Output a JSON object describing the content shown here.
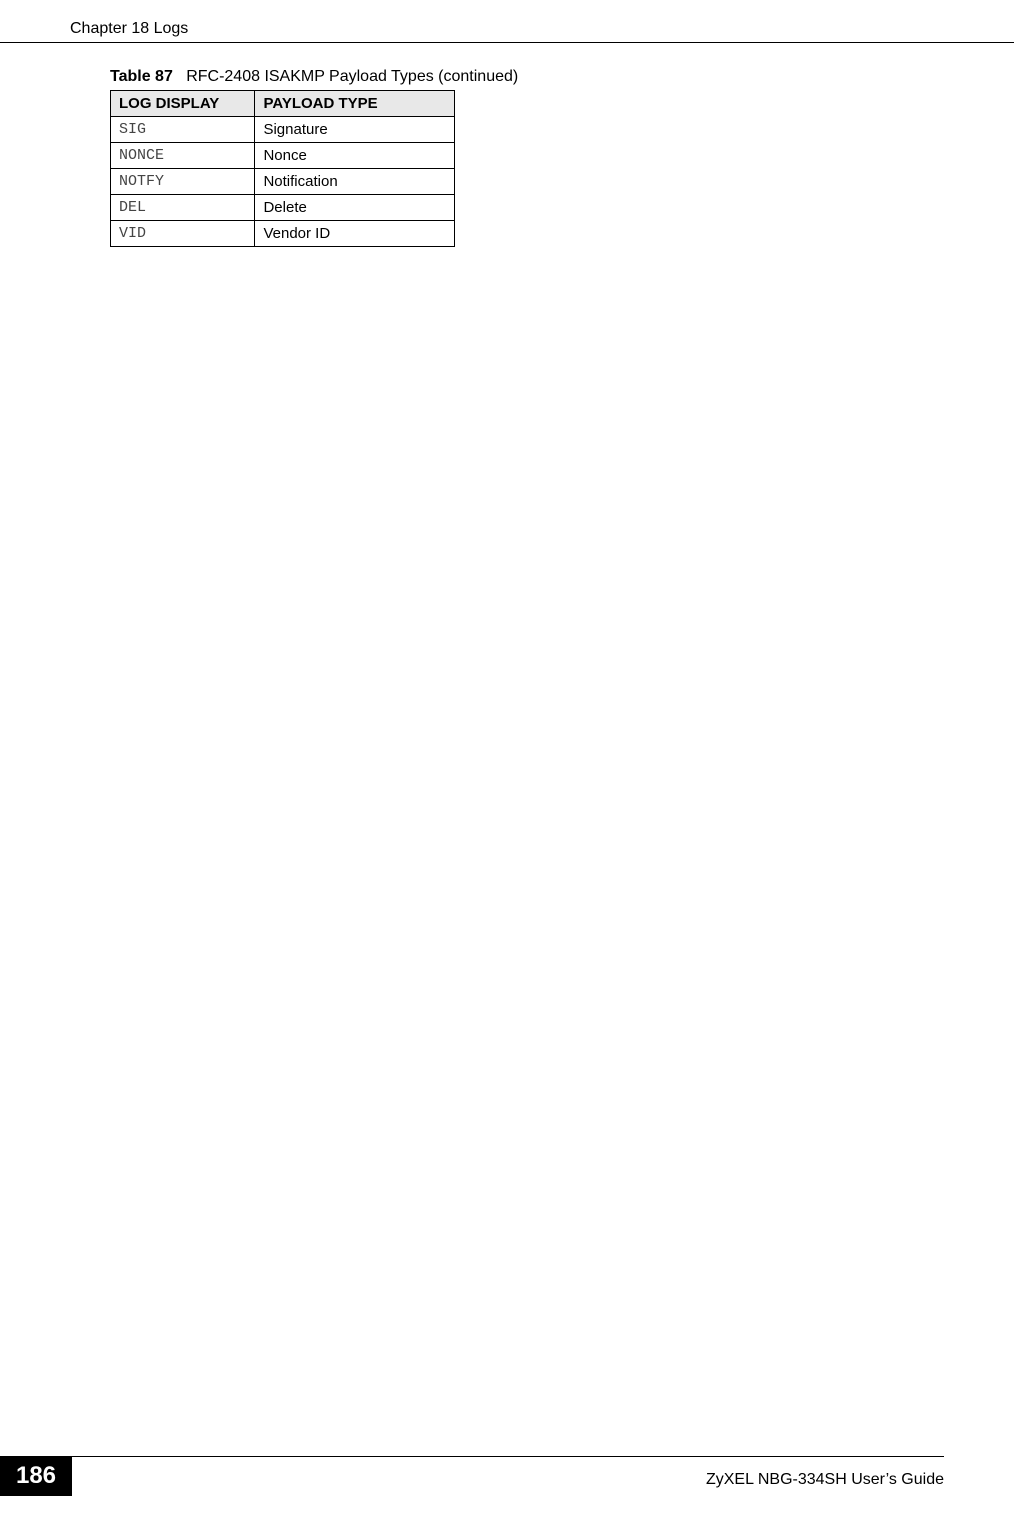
{
  "header": {
    "chapter": "Chapter 18 Logs"
  },
  "table": {
    "caption_prefix": "Table 87",
    "caption_text": "RFC-2408 ISAKMP Payload Types (continued)",
    "headers": {
      "log_display": "LOG DISPLAY",
      "payload_type": "PAYLOAD TYPE"
    },
    "rows": [
      {
        "log": "SIG",
        "payload": "Signature"
      },
      {
        "log": "NONCE",
        "payload": "Nonce"
      },
      {
        "log": "NOTFY",
        "payload": "Notification"
      },
      {
        "log": "DEL",
        "payload": "Delete"
      },
      {
        "log": "VID",
        "payload": "Vendor ID"
      }
    ]
  },
  "footer": {
    "page_number": "186",
    "guide": "ZyXEL NBG-334SH User’s Guide"
  }
}
